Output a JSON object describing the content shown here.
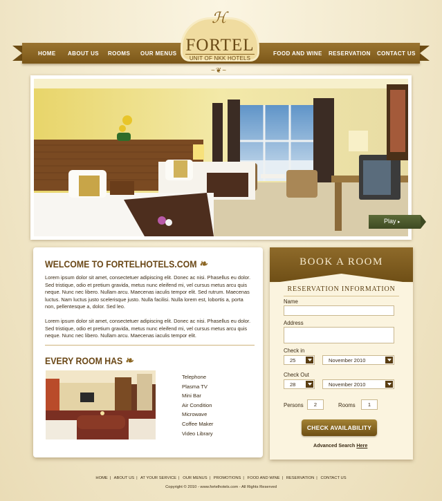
{
  "nav": {
    "left": [
      "HOME",
      "ABOUT US",
      "ROOMS",
      "OUR MENUS"
    ],
    "right": [
      "FOOD AND WINE",
      "RESERVATION",
      "CONTACT US"
    ]
  },
  "logo": {
    "name": "FORTEL",
    "tagline": "UNIT OF NKK HOTELS"
  },
  "hero": {
    "play_label": "Play"
  },
  "welcome": {
    "title": "WELCOME TO FORTELHOTELS.COM",
    "para1": "Lorem ipsum dolor sit amet, consectetuer adipiscing elit. Donec ac nisi. Phasellus eu dolor. Sed tristique, odio et pretium gravida, metus nunc eleifend mi, vel cursus metus arcu quis neque. Nunc nec libero. Nullam arcu. Maecenas iaculis tempor elit. Sed rutrum. Maecenas luctus. Nam luctus justo scelerisque justo. Nulla facilisi. Nulla lorem est, lobortis a, porta non, pellentesque a, dolor. Sed leo.",
    "para2": "Lorem ipsum dolor sit amet, consectetuer adipiscing elit. Donec ac nisi. Phasellus eu dolor. Sed tristique, odio et pretium gravida, metus nunc eleifend mi, vel cursus metus arcu quis neque. Nunc nec libero. Nullam arcu. Maecenas iaculis tempor elit."
  },
  "every_room": {
    "title": "EVERY ROOM HAS",
    "amenities": [
      "Telephone",
      "Plasma TV",
      "Mini Bar",
      "Air Condition",
      "Microwave",
      "Coffee Maker",
      "Video Library"
    ]
  },
  "booking": {
    "title": "BOOK A ROOM",
    "subtitle": "RESERVATION INFORMATION",
    "name_label": "Name",
    "address_label": "Address",
    "checkin_label": "Check in",
    "checkin_day": "25",
    "checkin_month": "November 2010",
    "checkout_label": "Check Out",
    "checkout_day": "28",
    "checkout_month": "November 2010",
    "persons_label": "Persons",
    "persons_value": "2",
    "rooms_label": "Rooms",
    "rooms_value": "1",
    "button_label": "CHECK AVAILABILITY",
    "advanced_prefix": "Advanced Search",
    "advanced_link": "Here"
  },
  "footer": {
    "links": [
      "HOME",
      "ABOUT US",
      "AT YOUR SERVICE",
      "OUR MENUS",
      "PROMOTIONS",
      "FOOD AND WINE",
      "RESERVATION",
      "CONTACT US"
    ],
    "copyright": "Copyright © 2010  -  www.fortelhotels.com  -  All Rights Reserved"
  },
  "colors": {
    "brand_brown": "#7b5718",
    "background_cream": "#f1e7c9",
    "play_green": "#4a5629"
  }
}
